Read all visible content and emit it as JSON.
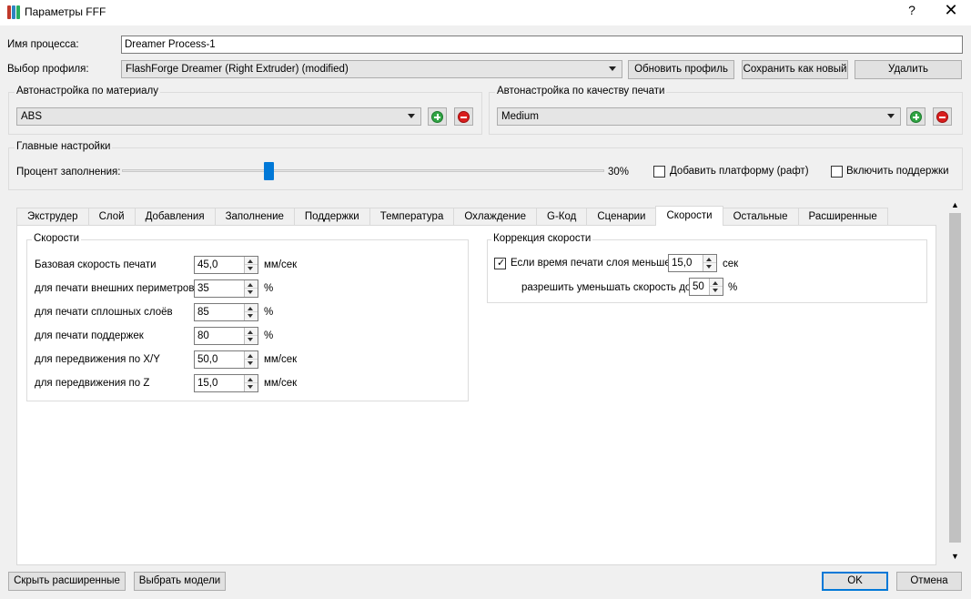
{
  "window": {
    "title": "Параметры FFF",
    "help_glyph": "?",
    "close_glyph": "✕",
    "icon": "fff-app-icon"
  },
  "process": {
    "label": "Имя процесса:",
    "value": "Dreamer Process-1"
  },
  "profile": {
    "label": "Выбор профиля:",
    "value": "FlashForge Dreamer (Right Extruder) (modified)",
    "update_button": "Обновить профиль",
    "save_new_button": "Сохранить как новый",
    "delete_button": "Удалить"
  },
  "auto_material": {
    "title": "Автонастройка по  материалу",
    "value": "ABS"
  },
  "auto_quality": {
    "title": "Автонастройка по качеству печати",
    "value": "Medium"
  },
  "main_settings": {
    "title": "Главные настройки",
    "infill_label": "Процент заполнения:",
    "infill_fraction": 0.3,
    "infill_value_text": "30%",
    "raft_label": "Добавить платформу (рафт)",
    "raft_checked": false,
    "supports_label": "Включить поддержки",
    "supports_checked": false
  },
  "tabs": [
    {
      "label": "Экструдер",
      "active": false
    },
    {
      "label": "Слой",
      "active": false
    },
    {
      "label": "Добавления",
      "active": false
    },
    {
      "label": "Заполнение",
      "active": false
    },
    {
      "label": "Поддержки",
      "active": false
    },
    {
      "label": "Температура",
      "active": false
    },
    {
      "label": "Охлаждение",
      "active": false
    },
    {
      "label": "G-Код",
      "active": false
    },
    {
      "label": "Сценарии",
      "active": false
    },
    {
      "label": "Скорости",
      "active": true
    },
    {
      "label": "Остальные",
      "active": false
    },
    {
      "label": "Расширенные",
      "active": false
    }
  ],
  "speeds": {
    "title": "Скорости",
    "rows": [
      {
        "label": "Базовая скорость печати",
        "value": "45,0",
        "unit": "мм/сек"
      },
      {
        "label": "для печати внешних периметров",
        "value": "35",
        "unit": "%"
      },
      {
        "label": "для печати сплошных слоёв",
        "value": "85",
        "unit": "%"
      },
      {
        "label": "для печати поддержек",
        "value": "80",
        "unit": "%"
      },
      {
        "label": "для передвижения по X/Y",
        "value": "50,0",
        "unit": "мм/сек"
      },
      {
        "label": "для передвижения по Z",
        "value": "15,0",
        "unit": "мм/сек"
      }
    ]
  },
  "speed_correction": {
    "title": "Коррекция скорости",
    "layer_time_label": "Если время печати слоя меньше",
    "layer_time_checked": true,
    "layer_time_value": "15,0",
    "layer_time_unit": "сек",
    "allow_reduce_label": "разрешить уменьшать скорость до",
    "allow_reduce_value": "50",
    "allow_reduce_unit": "%"
  },
  "footer": {
    "hide_advanced_button": "Скрыть расширенные",
    "select_models_button": "Выбрать модели",
    "ok_button": "OK",
    "cancel_button": "Отмена"
  },
  "colors": {
    "accent": "#0078d7",
    "add_green": "#2fa443",
    "remove_red": "#d91d1d",
    "icon_stripes": [
      "#c0392b",
      "#2e86c1",
      "#27ae60"
    ]
  }
}
